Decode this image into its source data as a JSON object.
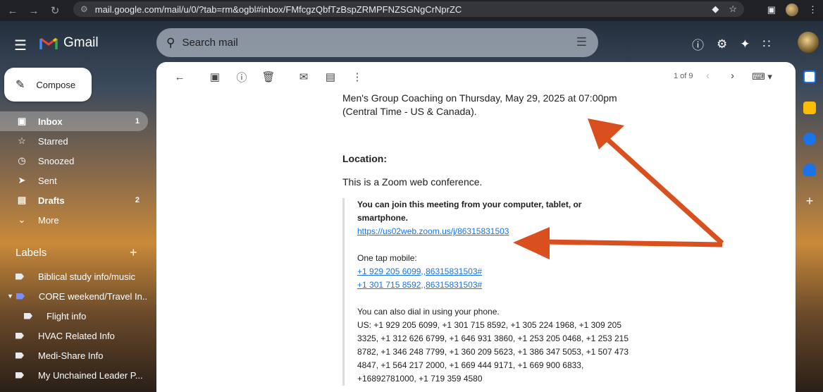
{
  "browser": {
    "url": "mail.google.com/mail/u/0/?tab=rm&ogbl#inbox/FMfcgzQbfTzBspZRMPFNZSGNgCrNprZC"
  },
  "header": {
    "app_name": "Gmail",
    "search_placeholder": "Search mail"
  },
  "compose_label": "Compose",
  "sidebar": {
    "items": [
      {
        "label": "Inbox",
        "count": "1",
        "icon": "inbox-icon"
      },
      {
        "label": "Starred",
        "count": "",
        "icon": "star-icon"
      },
      {
        "label": "Snoozed",
        "count": "",
        "icon": "clock-icon"
      },
      {
        "label": "Sent",
        "count": "",
        "icon": "send-icon"
      },
      {
        "label": "Drafts",
        "count": "2",
        "icon": "draft-icon"
      },
      {
        "label": "More",
        "count": "",
        "icon": "chevron-down-icon"
      }
    ],
    "labels_heading": "Labels",
    "labels": [
      "Biblical study info/music",
      "CORE weekend/Travel In...",
      "Flight info",
      "HVAC Related Info",
      "Medi-Share Info",
      "My Unchained Leader P..."
    ]
  },
  "toolbar": {
    "pager": "1 of 9"
  },
  "email": {
    "line1": "Men's Group Coaching on Thursday, May 29, 2025 at 07:00pm",
    "line2": "(Central Time - US & Canada).",
    "location_heading": "Location:",
    "location_text": "This is a Zoom web conference.",
    "join_text": "You can join this meeting from your computer, tablet, or smartphone.",
    "join_link": "https://us02web.zoom.us/j/86315831503",
    "one_tap_heading": "One tap mobile:",
    "one_tap_1": "+1 929 205 6099,,86315831503#",
    "one_tap_2": "+1 301 715 8592,,86315831503#",
    "dial_heading": "You can also dial in using your phone.",
    "dial_numbers": "US: +1 929 205 6099, +1 301 715 8592, +1 305 224 1968, +1 309 205 3325, +1 312 626 6799, +1 646 931 3860, +1 253 205 0468, +1 253 215 8782, +1 346 248 7799, +1 360 209 5623, +1 386 347 5053, +1 507 473 4847, +1 564 217 2000, +1 669 444 9171, +1 669 900 6833, +16892781000, +1 719 359 4580"
  },
  "colors": {
    "annotation_arrow": "#d9501e",
    "link": "#1a73e8"
  }
}
